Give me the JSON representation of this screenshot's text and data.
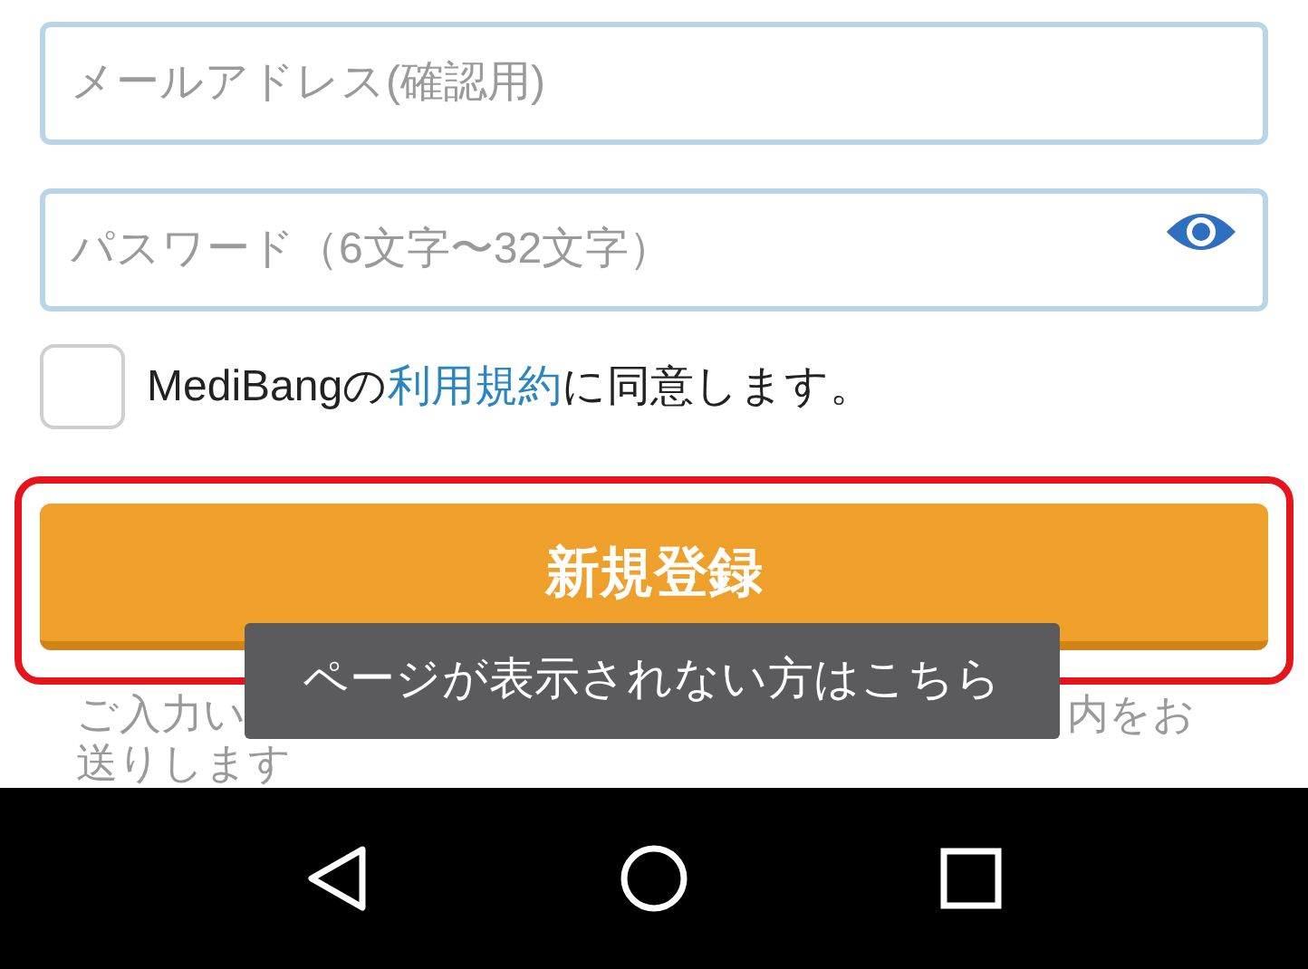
{
  "email_confirm_field": {
    "placeholder": "メールアドレス(確認用)"
  },
  "password_field": {
    "placeholder": "パスワード（6文字〜32文字）",
    "password_visible": false
  },
  "terms": {
    "checked": false,
    "before": "MediBangの",
    "link": "利用規約",
    "after": "に同意します。"
  },
  "register_button": {
    "label": "新規登録"
  },
  "notice_fragments": [
    "ご入力い",
    "内をお",
    "送りします"
  ],
  "toast": {
    "text": "ページが表示されない方はこちら"
  }
}
